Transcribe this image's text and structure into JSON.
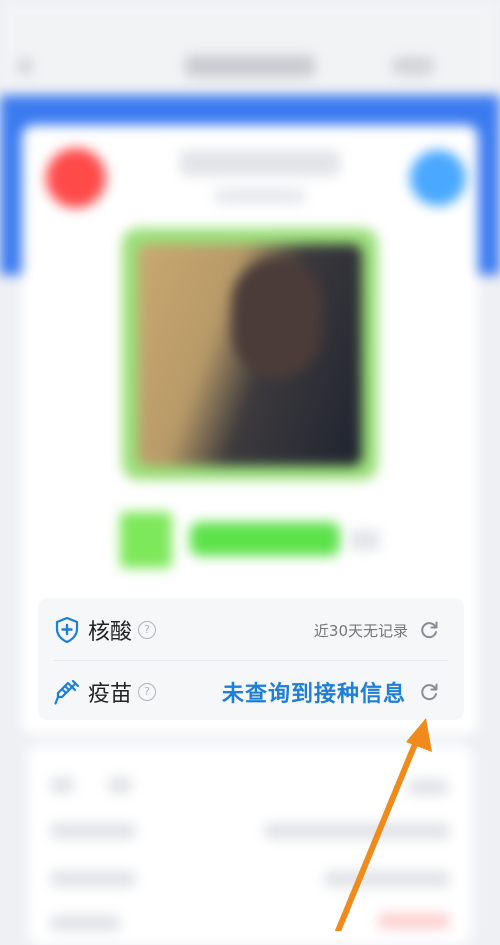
{
  "health_items": [
    {
      "label": "核酸",
      "help_glyph": "?",
      "status": "近30天无记录",
      "icon": "shield-plus-icon",
      "action_icon": "refresh-icon"
    },
    {
      "label": "疫苗",
      "help_glyph": "?",
      "status": "未查询到接种信息",
      "icon": "syringe-icon",
      "action_icon": "refresh-icon"
    }
  ],
  "colors": {
    "primary_blue": "#1d7fd8",
    "header_blue": "#3b7bf0",
    "health_green": "#5de24a",
    "annotation_orange": "#f08a1a"
  }
}
